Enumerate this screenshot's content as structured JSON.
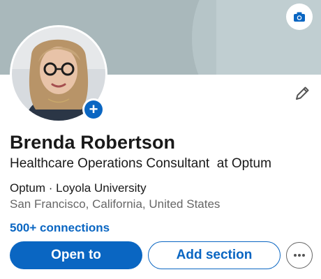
{
  "profile": {
    "name": "Brenda Robertson",
    "headline": "Healthcare Operations Consultant  at Optum",
    "company_education": "Optum · Loyola University",
    "location": "San Francisco, California, United States",
    "connections": "500+ connections"
  },
  "actions": {
    "open_to_label": "Open to",
    "add_section_label": "Add section"
  },
  "icons": {
    "banner_edit": "camera-icon",
    "avatar_add": "plus-icon",
    "profile_edit": "pencil-icon",
    "more": "more-horizontal-icon"
  },
  "colors": {
    "accent": "#0a66c2",
    "banner": "#a9b8bb",
    "secondary_text": "#666666"
  }
}
